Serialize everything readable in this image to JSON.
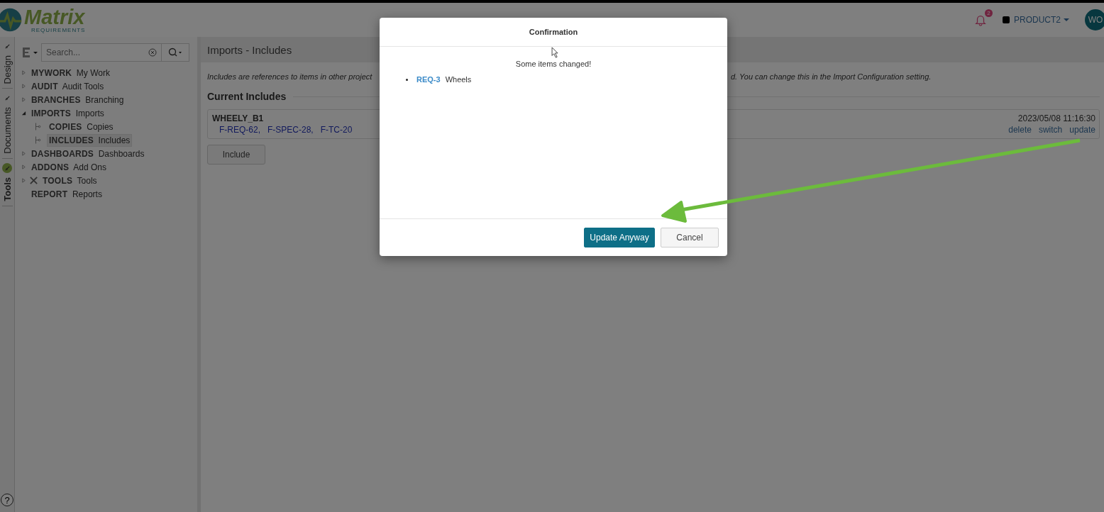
{
  "header": {
    "logo_name": "Matrix",
    "logo_sub": "REQUIREMENTS",
    "notification_count": "2",
    "project": "PRODUCT2",
    "avatar": "WO"
  },
  "side_tabs": [
    {
      "label": "Design",
      "selected": false
    },
    {
      "label": "Documents",
      "selected": false
    },
    {
      "label": "Tools",
      "selected": true
    }
  ],
  "help": "?",
  "search": {
    "placeholder": "Search..."
  },
  "tree": [
    {
      "code": "MYWORK",
      "label": "My Work",
      "kind": "folder",
      "expanded": false,
      "selected": false
    },
    {
      "code": "AUDIT",
      "label": "Audit Tools",
      "kind": "folder",
      "expanded": false,
      "selected": false
    },
    {
      "code": "BRANCHES",
      "label": "Branching",
      "kind": "folder",
      "expanded": false,
      "selected": false
    },
    {
      "code": "IMPORTS",
      "label": "Imports",
      "kind": "folder",
      "expanded": true,
      "selected": false,
      "children": [
        {
          "code": "COPIES",
          "label": "Copies",
          "kind": "branch",
          "selected": false
        },
        {
          "code": "INCLUDES",
          "label": "Includes",
          "kind": "branch",
          "selected": true
        }
      ]
    },
    {
      "code": "DASHBOARDS",
      "label": "Dashboards",
      "kind": "folder",
      "expanded": false,
      "selected": false
    },
    {
      "code": "ADDONS",
      "label": "Add Ons",
      "kind": "folder",
      "expanded": false,
      "selected": false
    },
    {
      "code": "TOOLS",
      "label": "Tools",
      "kind": "tools",
      "expanded": false,
      "selected": false
    },
    {
      "code": "REPORT",
      "label": "Reports",
      "kind": "leaf",
      "selected": false
    }
  ],
  "page": {
    "title": "Imports - Includes",
    "description_left": "Includes are references to items in other project",
    "description_right": "d. You can change this in the Import Configuration setting.",
    "section": "Current Includes",
    "includes": [
      {
        "name": "WHEELY_B1",
        "items": [
          "F-REQ-62,",
          "F-SPEC-28,",
          "F-TC-20"
        ],
        "date": "2023/05/08 11:16:30",
        "actions": [
          "delete",
          "switch",
          "update"
        ]
      }
    ],
    "include_button": "Include"
  },
  "dialog": {
    "title": "Confirmation",
    "message": "Some items changed!",
    "changes": [
      {
        "id": "REQ-3",
        "title": "Wheels"
      }
    ],
    "buttons": [
      {
        "label": "Update Anyway",
        "kind": "primary"
      },
      {
        "label": "Cancel",
        "kind": "default"
      }
    ]
  }
}
